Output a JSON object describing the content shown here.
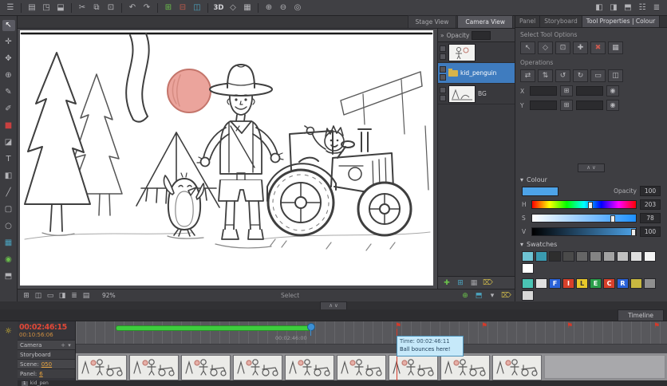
{
  "top_toolbar": {
    "icons": [
      {
        "glyph": "☰",
        "name": "main-menu-icon",
        "inter": "true"
      },
      {
        "glyph": "",
        "name": "toolbar-separator",
        "inter": "false"
      },
      {
        "glyph": "▤",
        "name": "new-scene-icon",
        "inter": "true"
      },
      {
        "glyph": "◳",
        "name": "open-scene-icon",
        "inter": "true"
      },
      {
        "glyph": "⬓",
        "name": "save-icon",
        "inter": "true"
      },
      {
        "glyph": "",
        "name": "toolbar-separator",
        "inter": "false"
      },
      {
        "glyph": "✂",
        "name": "cut-icon",
        "inter": "true"
      },
      {
        "glyph": "⧉",
        "name": "copy-icon",
        "inter": "true"
      },
      {
        "glyph": "⊡",
        "name": "paste-icon",
        "inter": "true"
      },
      {
        "glyph": "",
        "name": "toolbar-separator",
        "inter": "false"
      },
      {
        "glyph": "↶",
        "name": "undo-icon",
        "inter": "true"
      },
      {
        "glyph": "↷",
        "name": "redo-icon",
        "inter": "true"
      },
      {
        "glyph": "",
        "name": "toolbar-separator",
        "inter": "false"
      },
      {
        "glyph": "⊞",
        "name": "add-panel-icon",
        "color": "#6abf4b",
        "inter": "true"
      },
      {
        "glyph": "⊟",
        "name": "remove-panel-icon",
        "color": "#bf5a4b",
        "inter": "true"
      },
      {
        "glyph": "◫",
        "name": "duplicate-panel-icon",
        "color": "#4ba3bf",
        "inter": "true"
      },
      {
        "glyph": "",
        "name": "toolbar-separator",
        "inter": "false"
      },
      {
        "glyph": "3D",
        "name": "3d-toggle-button",
        "inter": "true"
      },
      {
        "glyph": "◇",
        "name": "camera-icon",
        "inter": "true"
      },
      {
        "glyph": "▦",
        "name": "grid-icon",
        "inter": "true"
      },
      {
        "glyph": "",
        "name": "toolbar-separator",
        "inter": "false"
      },
      {
        "glyph": "⊕",
        "name": "zoom-in-icon",
        "inter": "true"
      },
      {
        "glyph": "⊖",
        "name": "zoom-out-icon",
        "inter": "true"
      },
      {
        "glyph": "◎",
        "name": "reset-zoom-icon",
        "inter": "true"
      },
      {
        "glyph": "",
        "name": "toolbar-spacer",
        "inter": "false"
      },
      {
        "glyph": "◧",
        "name": "toggle-left-panel-icon",
        "inter": "true"
      },
      {
        "glyph": "◨",
        "name": "toggle-right-panel-icon",
        "inter": "true"
      },
      {
        "glyph": "⬒",
        "name": "toggle-top-panel-icon",
        "inter": "true"
      },
      {
        "glyph": "☷",
        "name": "workspace-icon",
        "inter": "true"
      },
      {
        "glyph": "≣",
        "name": "layout-menu-icon",
        "inter": "true"
      }
    ]
  },
  "left_toolbar": {
    "icons": [
      {
        "glyph": "↖",
        "name": "select-tool-icon",
        "inter": "true"
      },
      {
        "glyph": "✛",
        "name": "transform-tool-icon",
        "inter": "true"
      },
      {
        "glyph": "✥",
        "name": "hand-tool-icon",
        "inter": "true"
      },
      {
        "glyph": "⊕",
        "name": "zoom-tool-icon",
        "inter": "true"
      },
      {
        "glyph": "✎",
        "name": "pencil-tool-icon",
        "inter": "true"
      },
      {
        "glyph": "✐",
        "name": "pen-tool-icon",
        "inter": "true"
      },
      {
        "glyph": "■",
        "name": "colour-swatch-icon",
        "color": "#c84040",
        "inter": "true"
      },
      {
        "glyph": "◪",
        "name": "eraser-tool-icon",
        "inter": "true"
      },
      {
        "glyph": "T",
        "name": "text-tool-icon",
        "inter": "true"
      },
      {
        "glyph": "◧",
        "name": "paint-tool-icon",
        "inter": "true"
      },
      {
        "glyph": "╱",
        "name": "line-tool-icon",
        "inter": "true"
      },
      {
        "glyph": "▢",
        "name": "rectangle-tool-icon",
        "inter": "true"
      },
      {
        "glyph": "○",
        "name": "ellipse-tool-icon",
        "inter": "true"
      },
      {
        "glyph": "▦",
        "name": "layer-grid-icon",
        "color": "#4ba3bf",
        "inter": "true"
      },
      {
        "glyph": "◉",
        "name": "onion-skin-icon",
        "color": "#6abf4b",
        "inter": "true"
      },
      {
        "glyph": "⬒",
        "name": "panel-view-icon",
        "inter": "true"
      }
    ]
  },
  "view_tabs": {
    "tabs": [
      {
        "label": "Stage View"
      },
      {
        "label": "Camera View"
      }
    ]
  },
  "layers_panel": {
    "collapse_glyph": "»",
    "opacity_label": "Opacity",
    "layers": [
      {
        "name": ""
      },
      {
        "name": "kid_penguin"
      },
      {
        "name": "BG"
      }
    ],
    "footer_icons": [
      {
        "glyph": "✚",
        "name": "add-layer-icon",
        "color": "#6abf4b",
        "inter": "true"
      },
      {
        "glyph": "⊞",
        "name": "add-group-icon",
        "color": "#4ba3bf",
        "inter": "true"
      },
      {
        "glyph": "▦",
        "name": "duplicate-layer-icon",
        "color": "#a0a0a4",
        "inter": "true"
      },
      {
        "glyph": "⌦",
        "name": "delete-layer-icon",
        "color": "#c8b44a",
        "inter": "true"
      }
    ]
  },
  "right_panel": {
    "tabs": [
      {
        "label": "Panel"
      },
      {
        "label": "Storyboard"
      },
      {
        "label": "Tool Properties | Colour"
      }
    ],
    "select_tool_options": {
      "title": "Select Tool Options",
      "icons": [
        {
          "glyph": "↖",
          "name": "select-tool-icon",
          "inter": "true"
        },
        {
          "glyph": "◇",
          "name": "lasso-select-icon",
          "inter": "true"
        },
        {
          "glyph": "⊡",
          "name": "snap-option-icon",
          "inter": "true"
        },
        {
          "glyph": "✚",
          "name": "add-to-selection-icon",
          "inter": "true"
        },
        {
          "glyph": "✖",
          "name": "clear-selection-icon",
          "color": "#c85a50",
          "inter": "true"
        },
        {
          "glyph": "▦",
          "name": "group-selection-icon",
          "inter": "true"
        }
      ]
    },
    "operations": {
      "title": "Operations",
      "row1": [
        {
          "glyph": "⇄",
          "name": "flip-horizontal-icon",
          "inter": "true"
        },
        {
          "glyph": "⇅",
          "name": "flip-vertical-icon",
          "inter": "true"
        },
        {
          "glyph": "↺",
          "name": "rotate-ccw-icon",
          "inter": "true"
        },
        {
          "glyph": "↻",
          "name": "rotate-cw-icon",
          "inter": "true"
        },
        {
          "glyph": "▭",
          "name": "fit-to-panel-icon",
          "inter": "true"
        },
        {
          "glyph": "◫",
          "name": "distribute-icon",
          "inter": "true"
        }
      ],
      "field_x_label": "X",
      "field_y_label": "Y",
      "mini1_glyph": "⊞",
      "mini2_glyph": "◉"
    },
    "splitter_glyphs": "∧ ∨",
    "colour": {
      "collapse_glyph": "▾",
      "title": "Colour",
      "current_color": "#4da3e8",
      "opacity_label": "Opacity",
      "opacity_value": "100",
      "h_label": "H",
      "h_value": "203",
      "h_pos": "56%",
      "s_label": "S",
      "s_value": "78",
      "s_pos": "78%",
      "v_label": "V",
      "v_value": "100",
      "v_pos": "98%",
      "swatches_title": "Swatches",
      "swatches_menu_glyph": "▾",
      "swatch_row1": [
        {
          "bg": "#6fc4d4",
          "ch": "",
          "fg": "#000000",
          "name": "colour-swatch",
          "inter": "true"
        },
        {
          "bg": "#3a9ab0",
          "ch": "",
          "fg": "#000000",
          "name": "colour-swatch",
          "inter": "true"
        },
        {
          "bg": "#2e2e2e",
          "ch": "",
          "fg": "#000000",
          "name": "colour-swatch",
          "inter": "true"
        },
        {
          "bg": "#4a4a4a",
          "ch": "",
          "fg": "#000000",
          "name": "colour-swatch",
          "inter": "true"
        },
        {
          "bg": "#666666",
          "ch": "",
          "fg": "#000000",
          "name": "colour-swatch",
          "inter": "true"
        },
        {
          "bg": "#848484",
          "ch": "",
          "fg": "#000000",
          "name": "colour-swatch",
          "inter": "true"
        },
        {
          "bg": "#a2a2a2",
          "ch": "",
          "fg": "#000000",
          "name": "colour-swatch",
          "inter": "true"
        },
        {
          "bg": "#c0c0c0",
          "ch": "",
          "fg": "#000000",
          "name": "colour-swatch",
          "inter": "true"
        },
        {
          "bg": "#dedede",
          "ch": "",
          "fg": "#000000",
          "name": "colour-swatch",
          "inter": "true"
        },
        {
          "bg": "#f4f4f4",
          "ch": "",
          "fg": "#000000",
          "name": "colour-swatch",
          "inter": "true"
        },
        {
          "bg": "#ffffff",
          "ch": "",
          "fg": "#000000",
          "name": "colour-swatch",
          "inter": "true"
        }
      ],
      "swatch_row2": [
        {
          "bg": "#4ac4b4",
          "ch": "",
          "fg": "#000000",
          "name": "colour-swatch",
          "inter": "true"
        },
        {
          "bg": "#e0e0e0",
          "ch": "",
          "fg": "#000000",
          "name": "colour-swatch",
          "inter": "true"
        },
        {
          "bg": "#2a62d8",
          "ch": "F",
          "fg": "#ffffff",
          "name": "colour-swatch",
          "inter": "true"
        },
        {
          "bg": "#d8402a",
          "ch": "I",
          "fg": "#ffffff",
          "name": "colour-swatch",
          "inter": "true"
        },
        {
          "bg": "#e8c82a",
          "ch": "L",
          "fg": "#333333",
          "name": "colour-swatch",
          "inter": "true"
        },
        {
          "bg": "#2a9e4a",
          "ch": "E",
          "fg": "#ffffff",
          "name": "colour-swatch",
          "inter": "true"
        },
        {
          "bg": "#d8402a",
          "ch": "C",
          "fg": "#ffffff",
          "name": "colour-swatch",
          "inter": "true"
        },
        {
          "bg": "#2a62d8",
          "ch": "R",
          "fg": "#ffffff",
          "name": "colour-swatch",
          "inter": "true"
        },
        {
          "bg": "#c8b840",
          "ch": "",
          "fg": "#000000",
          "name": "colour-swatch",
          "inter": "true"
        },
        {
          "bg": "#909090",
          "ch": "",
          "fg": "#000000",
          "name": "colour-swatch",
          "inter": "true"
        },
        {
          "bg": "#d8d8d8",
          "ch": "",
          "fg": "#000000",
          "name": "colour-swatch",
          "inter": "true"
        }
      ]
    }
  },
  "status_bar": {
    "left_icons": [
      {
        "glyph": "⊞",
        "name": "thumbnails-view-icon",
        "inter": "true"
      },
      {
        "glyph": "◫",
        "name": "split-view-icon",
        "inter": "true"
      },
      {
        "glyph": "▭",
        "name": "single-view-icon",
        "inter": "true"
      },
      {
        "glyph": "◨",
        "name": "side-by-side-icon",
        "inter": "true"
      },
      {
        "glyph": "≣",
        "name": "list-view-icon",
        "inter": "true"
      },
      {
        "glyph": "▤",
        "name": "rows-view-icon",
        "inter": "true"
      }
    ],
    "zoom": "92%",
    "hint": "Select",
    "right_icons": [
      {
        "glyph": "⊕",
        "name": "add-icon",
        "color": "#6abf4b",
        "inter": "true"
      },
      {
        "glyph": "⬒",
        "name": "panel-toggle-icon",
        "color": "#4ba3bf",
        "inter": "true"
      },
      {
        "glyph": "▾",
        "name": "options-menu-icon",
        "inter": "true"
      },
      {
        "glyph": "⌦",
        "name": "delete-icon",
        "color": "#c8b44a",
        "inter": "true"
      }
    ]
  },
  "splitter": {
    "glyphs": "∧ ∨"
  },
  "timeline": {
    "tab_label": "Timeline",
    "current_time": "00:02:46:15",
    "total_time": "00:10:56:06",
    "ruler_label": "00:02:46:00",
    "marker_glyph": "⚑",
    "bulb_glyph": "☼",
    "tracks": {
      "camera_label": "Camera",
      "camera_add_glyph": "+",
      "camera_menu_glyph": "▾",
      "storyboard_label": "Storyboard",
      "scene_label": "Scene:",
      "scene_value": "050",
      "panel_label": "Panel:",
      "panel_value": "6"
    },
    "tooltip": {
      "line1": "Time: 00:02:46:11",
      "line2": "Ball bounces here!"
    },
    "bottom_track": {
      "index": "1",
      "name": "kid_pen"
    },
    "panels": [
      {},
      {},
      {},
      {},
      {},
      {},
      {},
      {},
      {}
    ]
  }
}
